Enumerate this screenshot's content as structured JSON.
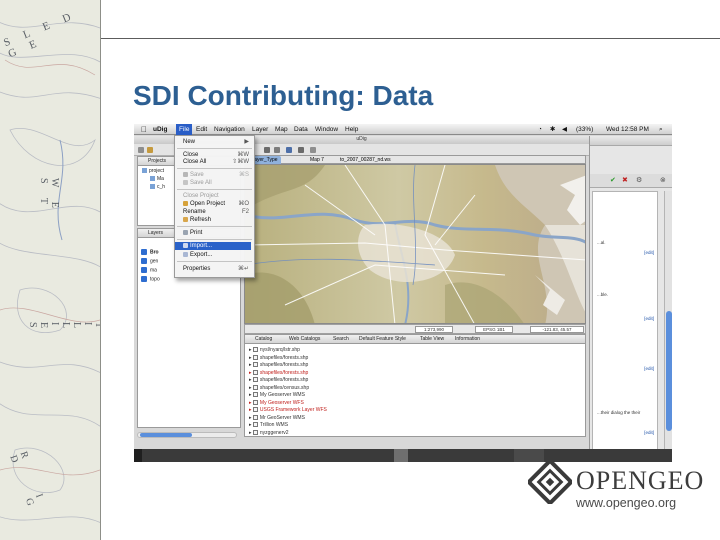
{
  "slide": {
    "title": "SDI Contributing: Data"
  },
  "map_strip": {
    "labels": [
      "S L E D G E",
      "W E S T",
      "T I L L I E S",
      "R I D G"
    ]
  },
  "mac_menubar": {
    "app": "uDig",
    "items": [
      "File",
      "Edit",
      "Navigation",
      "Layer",
      "Map",
      "Data",
      "Window",
      "Help"
    ],
    "battery": "(33%)",
    "clock": "Wed 12:58 PM"
  },
  "window_title": "uDig",
  "file_menu": {
    "items": [
      {
        "label": "New",
        "shortcut": "▶",
        "enabled": true
      },
      {
        "label": "Close",
        "shortcut": "⌘W",
        "enabled": true
      },
      {
        "label": "Close All",
        "shortcut": "⇧⌘W",
        "enabled": true
      },
      {
        "label": "Save",
        "shortcut": "⌘S",
        "enabled": false
      },
      {
        "label": "Save All",
        "shortcut": "",
        "enabled": false
      },
      {
        "label": "Close Project",
        "shortcut": "",
        "enabled": false
      },
      {
        "label": "Open Project",
        "shortcut": "⌘O",
        "enabled": true
      },
      {
        "label": "Rename",
        "shortcut": "F2",
        "enabled": true
      },
      {
        "label": "Refresh",
        "shortcut": "",
        "enabled": true
      },
      {
        "label": "Print",
        "shortcut": "",
        "enabled": true
      },
      {
        "label": "Import...",
        "shortcut": "",
        "enabled": true,
        "highlighted": true
      },
      {
        "label": "Export...",
        "shortcut": "",
        "enabled": true
      },
      {
        "label": "Properties",
        "shortcut": "⌘↵",
        "enabled": true
      }
    ]
  },
  "projects_panel": {
    "tab": "Projects",
    "rows": [
      "project",
      "Ma",
      "c_h"
    ]
  },
  "layers_panel": {
    "tab": "Layers",
    "rows": [
      "Bro",
      "gen",
      "ma",
      "topo"
    ]
  },
  "map_tabs": [
    "...ayer_Type",
    "Map 7",
    "to_2007_00287_nd.ws"
  ],
  "status": [
    "1:273,990",
    "EPSG 1B1",
    "-121.83, 45.57"
  ],
  "catalog": {
    "tabs": [
      "Catalog",
      "Web Catalogs",
      "Search",
      "Default Feature Style",
      "Table View",
      "Information"
    ],
    "rows": [
      {
        "label": "nysl/nyarq/lstr.shp",
        "red": false
      },
      {
        "label": "shapefiles/forests.shp",
        "red": false
      },
      {
        "label": "shapefiles/forests.shp",
        "red": false
      },
      {
        "label": "shapefiles/forests.shp",
        "red": true
      },
      {
        "label": "shapefiles/forests.shp",
        "red": false
      },
      {
        "label": "shapefiles/census.shp",
        "red": false
      },
      {
        "label": "My Geoserver WMS",
        "red": false
      },
      {
        "label": "My Geoserver WFS",
        "red": true
      },
      {
        "label": "USGS Framework Layer WFS",
        "red": true
      },
      {
        "label": "Mr GeoServer WMS",
        "red": false
      },
      {
        "label": "Trillion WMS",
        "red": false
      },
      {
        "label": "nyzggenerv2",
        "red": false
      }
    ]
  },
  "right_window": {
    "edit_label": "[edit]",
    "texts": [
      "...al.",
      "...ble.",
      "...their dialog the their"
    ]
  },
  "logo": {
    "name": "OPENGEO",
    "url": "www.opengeo.org"
  }
}
